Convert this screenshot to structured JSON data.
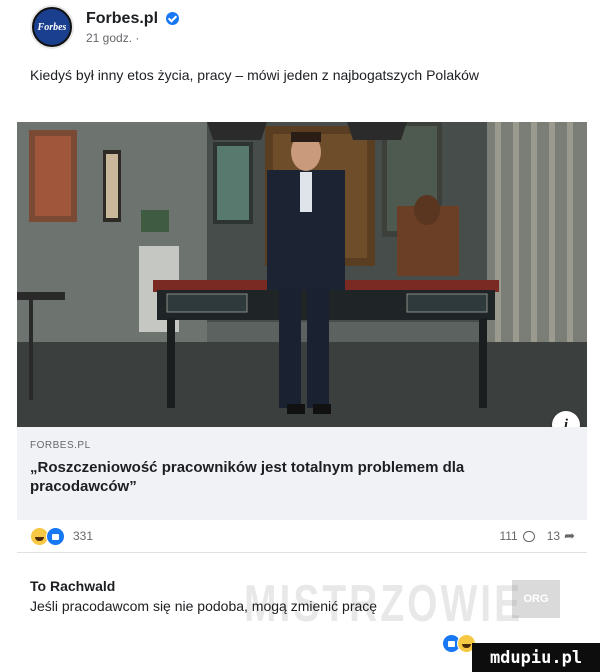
{
  "header": {
    "page_name": "Forbes.pl",
    "time": "21 godz. ·",
    "avatar_text": "Forbes"
  },
  "post": {
    "text": "Kiedyś był inny etos życia, pracy – mówi jeden z najbogatszych Polaków"
  },
  "link_preview": {
    "domain": "FORBES.PL",
    "title": "„Roszczeniowość pracowników jest totalnym problemem dla pracodawców”",
    "info_icon": "i"
  },
  "reactions": {
    "count": "331",
    "comments": "111",
    "shares": "13"
  },
  "comment": {
    "author": "To Rachwald",
    "text": "Jeśli pracodawcom się nie podoba, mogą zmienić pracę"
  },
  "watermark": {
    "text": "MISTRZOWIE",
    "org": "ORG"
  },
  "brand_badge": "mdupiu.pl",
  "colors": {
    "like_blue": "#1877f2",
    "haha_yellow": "#f7c843",
    "link_box_bg": "#f0f2f5",
    "muted_text": "#65676b"
  },
  "icons": [
    "verified-badge-icon",
    "info-icon",
    "haha-reaction-icon",
    "like-reaction-icon",
    "comment-icon",
    "share-icon"
  ]
}
